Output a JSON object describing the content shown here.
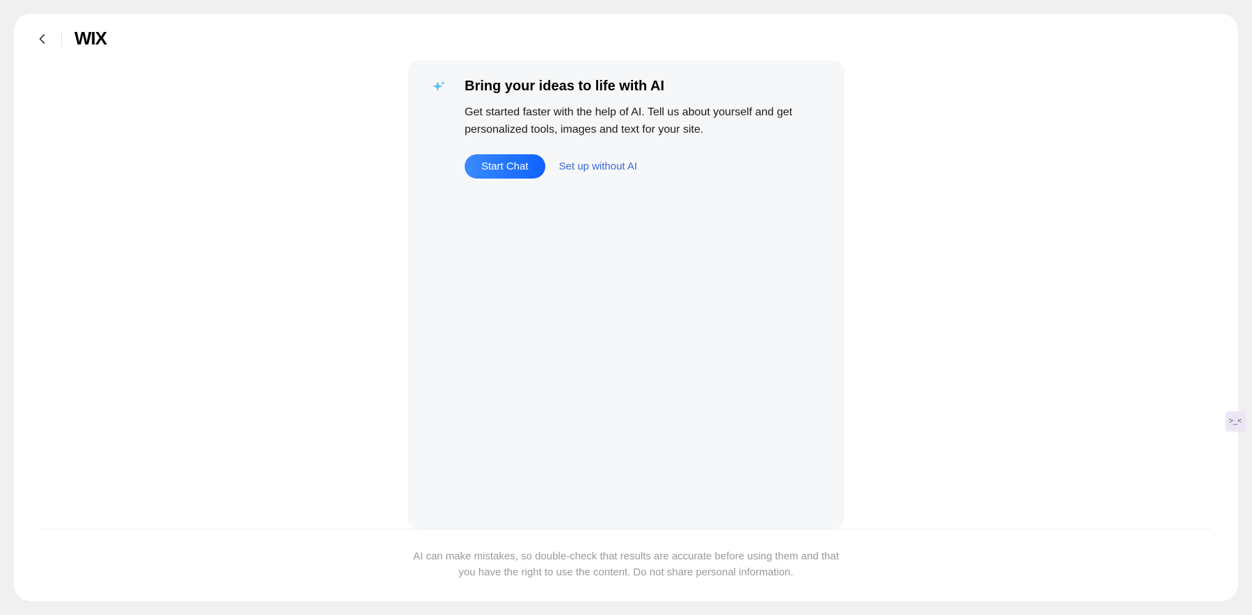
{
  "header": {
    "logo": "WIX"
  },
  "aiCard": {
    "title": "Bring your ideas to life with AI",
    "description": "Get started faster with the help of AI. Tell us about yourself and get personalized tools, images and text for your site.",
    "primaryButton": "Start Chat",
    "secondaryLink": "Set up without AI"
  },
  "footer": {
    "disclaimer": "AI can make mistakes, so double-check that results are accurate before using them and that you have the right to use the content. Do not share personal information."
  }
}
